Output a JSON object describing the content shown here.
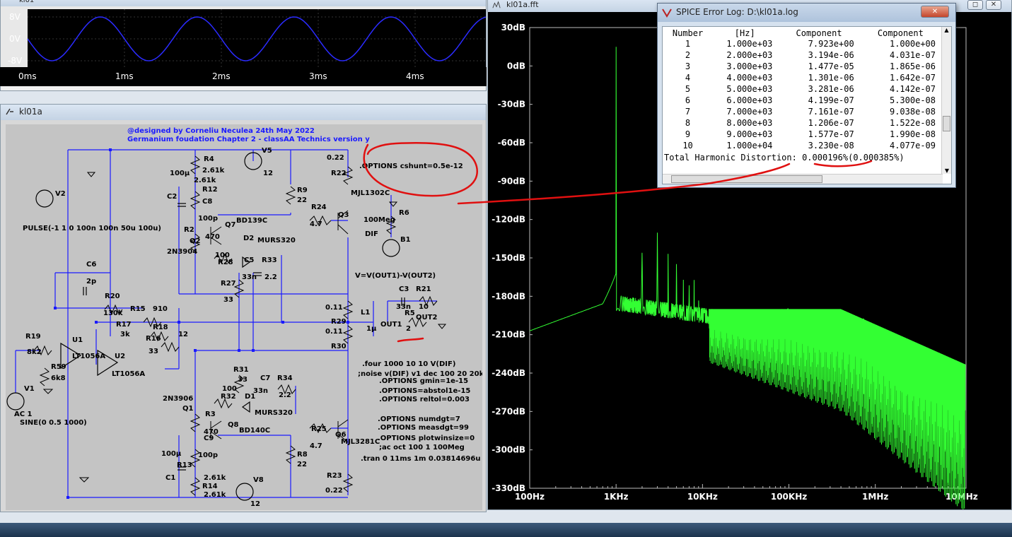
{
  "windows": {
    "wave_title": "kl01",
    "schem_title": "kl01a",
    "fft_title": "kl01a.fft",
    "log_title": "SPICE Error Log: D:\\kl01a.log"
  },
  "wave": {
    "y_labels": [
      "8V",
      "0V",
      "-8V"
    ],
    "x_labels": [
      "0ms",
      "1ms",
      "2ms",
      "3ms",
      "4ms"
    ]
  },
  "fft": {
    "y_labels": [
      "30dB",
      "0dB",
      "-30dB",
      "-60dB",
      "-90dB",
      "-120dB",
      "-150dB",
      "-180dB",
      "-210dB",
      "-240dB",
      "-270dB",
      "-300dB",
      "-330dB"
    ],
    "x_labels": [
      "100Hz",
      "1KHz",
      "10KHz",
      "100KHz",
      "1MHz",
      "10MHz"
    ],
    "trace_color": "#33ff33"
  },
  "log": {
    "headers": [
      "Number",
      "[Hz]",
      "Component",
      "Component"
    ],
    "rows": [
      [
        "1",
        "1.000e+03",
        "7.923e+00",
        "1.000e+00"
      ],
      [
        "2",
        "2.000e+03",
        "3.194e-06",
        "4.031e-07"
      ],
      [
        "3",
        "3.000e+03",
        "1.477e-05",
        "1.865e-06"
      ],
      [
        "4",
        "4.000e+03",
        "1.301e-06",
        "1.642e-07"
      ],
      [
        "5",
        "5.000e+03",
        "3.281e-06",
        "4.142e-07"
      ],
      [
        "6",
        "6.000e+03",
        "4.199e-07",
        "5.300e-08"
      ],
      [
        "7",
        "7.000e+03",
        "7.161e-07",
        "9.038e-08"
      ],
      [
        "8",
        "8.000e+03",
        "1.206e-07",
        "1.522e-08"
      ],
      [
        "9",
        "9.000e+03",
        "1.577e-07",
        "1.990e-08"
      ],
      [
        "10",
        "1.000e+04",
        "3.230e-08",
        "4.077e-09"
      ]
    ],
    "thd_label": "Total Harmonic Distortion:",
    "thd_value": "0.000196%(0.000385%)"
  },
  "schem": {
    "header1": "@designed by Corneliu Neculea 24th May 2022",
    "header2": "Germanium foudation Chapter 2 - classAA Technics version y",
    "pulse": "PULSE(-1 1 0 100n 100n 50u 100u)",
    "ac": "AC 1",
    "sine": "SINE(0 0.5 1000)",
    "cshunt": ".OPTIONS cshunt=0.5e-12",
    "vdif": "V=V(OUT1)-V(OUT2)",
    "directives": [
      ".four 1000 10 10 V(DIF)",
      ";noise v(DIF) v1 dec 100 20 20k",
      ".OPTIONS gmin=1e-15",
      ".OPTIONS=abstol1e-15",
      ".OPTIONS reltol=0.003",
      ".OPTIONS numdgt=7",
      ".OPTIONS measdgt=99",
      ".OPTIONS plotwinsize=0",
      ";ac oct 100 1 100Meg",
      ".tran 0 11ms 1m 0.03814696u"
    ],
    "labels": {
      "V2": "V2",
      "V5": "V5",
      "V5v": "12",
      "V8": "V8",
      "V8v": "12",
      "V1": "V1",
      "B1": "B1",
      "R4": "R4",
      "R4v": "2.61k",
      "C8": "C8",
      "C8v": "100p",
      "R12": "R12",
      "R12v": "2.61k",
      "C2": "C2",
      "c100u": "100µ",
      "R2": "R2",
      "R2v": "470",
      "Q7": "Q7",
      "BD139C": "BD139C",
      "D2": "D2",
      "MURS320a": "MURS320",
      "Q2": "Q2",
      "N3904": "2N3904",
      "R28": "R28",
      "R28v": "100",
      "C5": "C5",
      "C5v": "33n",
      "R33": "R33",
      "R33v": "2.2",
      "R27": "R27",
      "R27v": "33",
      "C6": "C6",
      "C6v": "2p",
      "R20": "R20",
      "R20v": "130k",
      "R15": "R15",
      "R15v": "910",
      "R17": "R17",
      "R17v": "3k",
      "R18": "R18",
      "R18v": "12",
      "R16": "R16",
      "R16v": "33",
      "R19": "R19",
      "R19v": "8k2",
      "U1": "U1",
      "U2": "U2",
      "LT1056A": "LT1056A",
      "LT1056A2": "LT1056A",
      "R59": "R59",
      "R59v": "6k8",
      "R9": "R9",
      "R9v": "22",
      "R24": "R24",
      "R24v": "4.7",
      "Q3": "Q3",
      "MJL1302C": "MJL1302C",
      "R22": "R22",
      "R22v": "0.22",
      "R6": "R6",
      "R6v": "100Meg",
      "DIF": "DIF",
      "C3": "C3",
      "C3v": "33n",
      "R21": "R21",
      "R21v": "10",
      "R5": "R5",
      "R5v": "2",
      "R29": "R29",
      "R29a": "0.11",
      "R29b": "0.11",
      "L1": "L1",
      "L1v": "1µ",
      "OUT1": "OUT1",
      "OUT2": "OUT2",
      "R30": "R30",
      "R31": "R31",
      "R31v": "33",
      "C7": "C7",
      "C7v": "33n",
      "R34": "R34",
      "R34v": "2.2",
      "N3906": "2N3906",
      "Q1": "Q1",
      "R32": "R32",
      "R32v": "100",
      "D1": "D1",
      "MURS320b": "MURS320",
      "R3": "R3",
      "R3v": "470",
      "Q8": "Q8",
      "BD140C": "BD140C",
      "C9": "C9",
      "C9v": "100p",
      "R25": "R25",
      "R25v": "4.7",
      "Q6": "Q6",
      "MJL3281C": "MJL3281C",
      "R8": "R8",
      "R8v": "22",
      "C1": "C1",
      "R13": "R13",
      "R13v": "2.61k",
      "R14": "R14",
      "R14v": "2.61k",
      "R23": "R23",
      "R23v": "0.22",
      "c100u2": "100µ"
    }
  }
}
